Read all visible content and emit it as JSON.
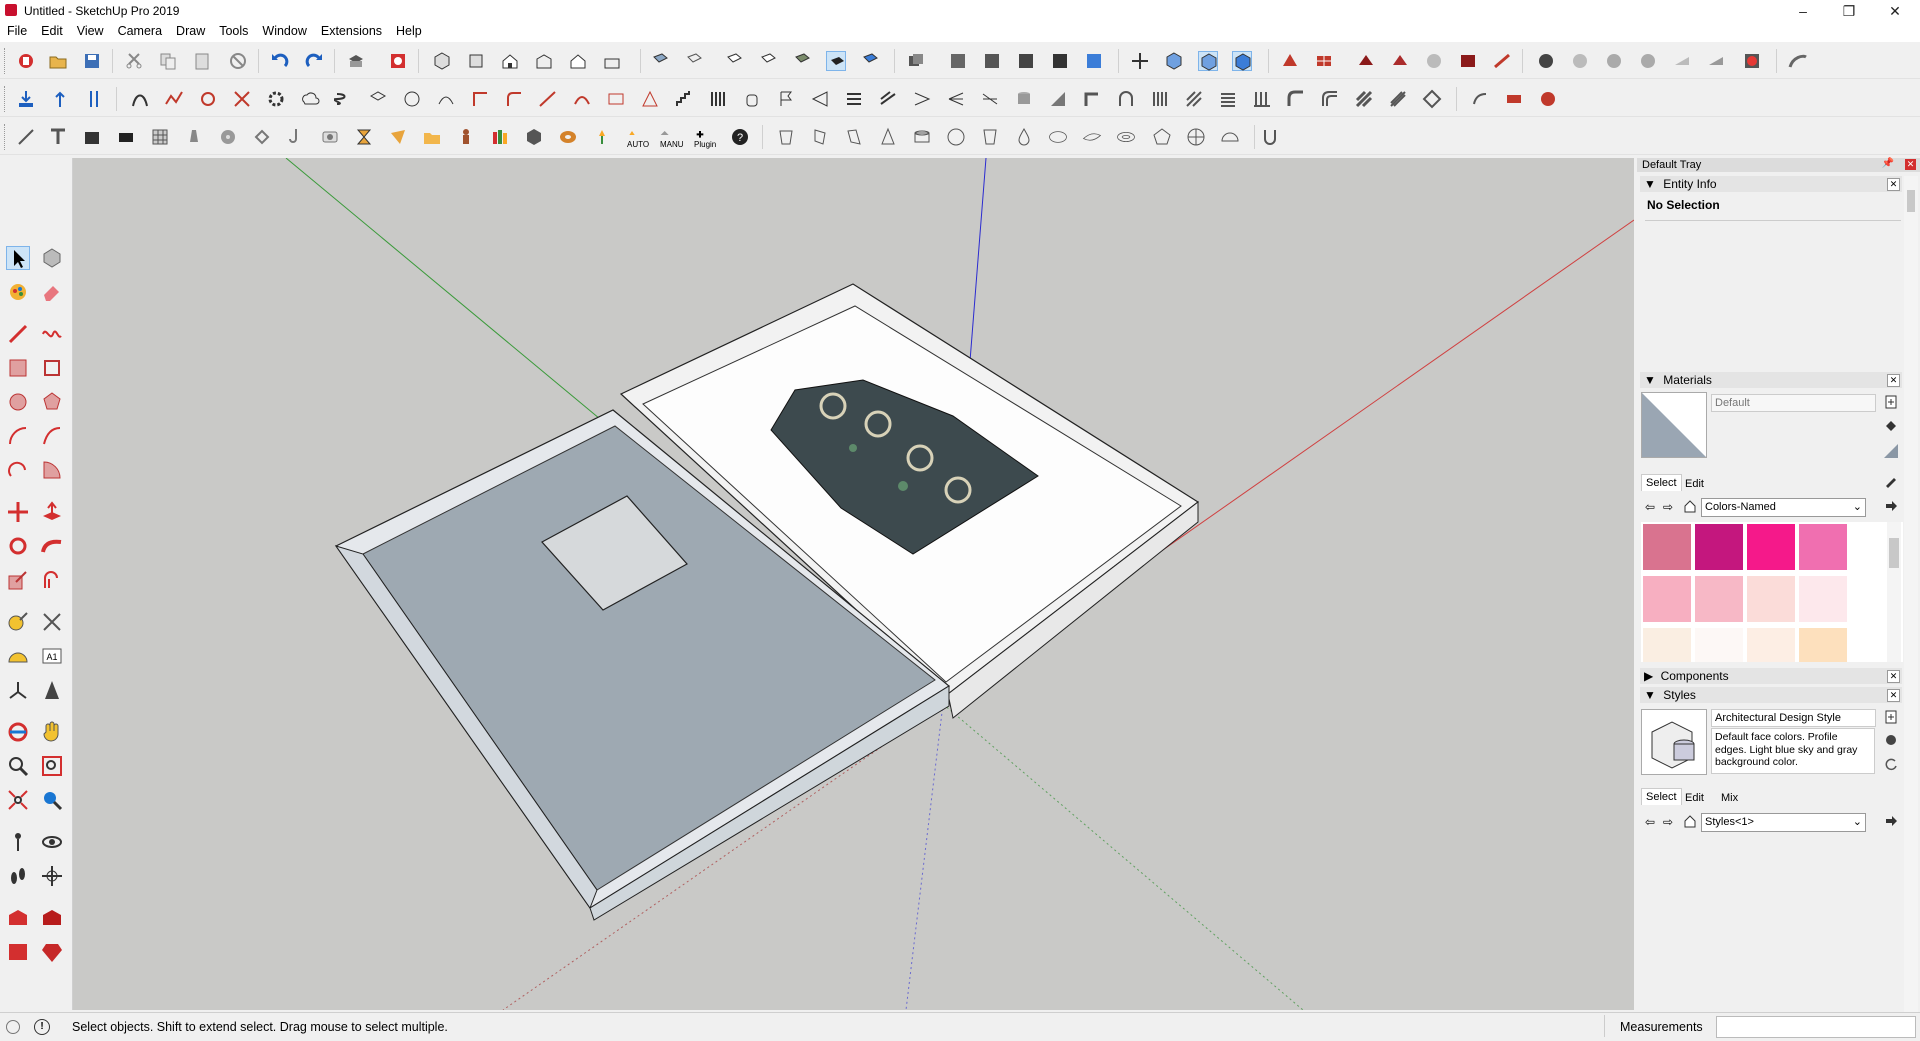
{
  "window": {
    "title": "Untitled - SketchUp Pro 2019",
    "minimize": "–",
    "restore": "❐",
    "close": "✕"
  },
  "menu": [
    "File",
    "Edit",
    "View",
    "Camera",
    "Draw",
    "Tools",
    "Window",
    "Extensions",
    "Help"
  ],
  "toolbar": {
    "auto_label": "AUTO",
    "manu_label": "MANU",
    "plugin_label": "Plugin"
  },
  "tray": {
    "title": "Default Tray",
    "entity_info": {
      "title": "Entity Info",
      "value": "No Selection"
    },
    "materials": {
      "title": "Materials",
      "name": "Default",
      "tabs": [
        "Select",
        "Edit"
      ],
      "library": "Colors-Named",
      "swatches": [
        "#d9738f",
        "#c4177e",
        "#f5198a",
        "#f06fb0",
        "#f7afc1",
        "#f7b8c6",
        "#fbdcd9",
        "#fde8ec",
        "#faeee2",
        "#fdf8f6",
        "#fdeee4",
        "#fde0bd"
      ]
    },
    "components": {
      "title": "Components"
    },
    "styles": {
      "title": "Styles",
      "name": "Architectural Design Style",
      "description": "Default face colors. Profile edges. Light blue sky and gray background color.",
      "tabs": [
        "Select",
        "Edit",
        "Mix"
      ],
      "collection": "Styles<1>"
    }
  },
  "status": {
    "message": "Select objects. Shift to extend select. Drag mouse to select multiple.",
    "measurements_label": "Measurements",
    "measurements_value": ""
  },
  "colors": {
    "viewport_bg": "#c9c9c7",
    "box_inner": "#9caab5",
    "box_top": "#d8dde2",
    "selection_highlight": "#cde4f7"
  }
}
